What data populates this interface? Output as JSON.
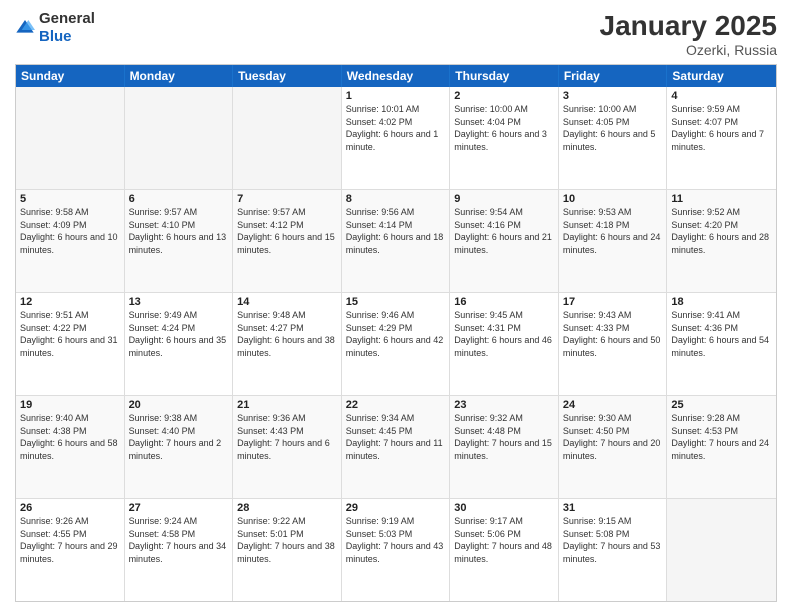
{
  "header": {
    "logo_general": "General",
    "logo_blue": "Blue",
    "title": "January 2025",
    "location": "Ozerki, Russia"
  },
  "days_of_week": [
    "Sunday",
    "Monday",
    "Tuesday",
    "Wednesday",
    "Thursday",
    "Friday",
    "Saturday"
  ],
  "weeks": [
    {
      "cells": [
        {
          "day": "",
          "empty": true
        },
        {
          "day": "",
          "empty": true
        },
        {
          "day": "",
          "empty": true
        },
        {
          "day": "1",
          "sunrise": "Sunrise: 10:01 AM",
          "sunset": "Sunset: 4:02 PM",
          "daylight": "Daylight: 6 hours and 1 minute."
        },
        {
          "day": "2",
          "sunrise": "Sunrise: 10:00 AM",
          "sunset": "Sunset: 4:04 PM",
          "daylight": "Daylight: 6 hours and 3 minutes."
        },
        {
          "day": "3",
          "sunrise": "Sunrise: 10:00 AM",
          "sunset": "Sunset: 4:05 PM",
          "daylight": "Daylight: 6 hours and 5 minutes."
        },
        {
          "day": "4",
          "sunrise": "Sunrise: 9:59 AM",
          "sunset": "Sunset: 4:07 PM",
          "daylight": "Daylight: 6 hours and 7 minutes."
        }
      ]
    },
    {
      "cells": [
        {
          "day": "5",
          "sunrise": "Sunrise: 9:58 AM",
          "sunset": "Sunset: 4:09 PM",
          "daylight": "Daylight: 6 hours and 10 minutes."
        },
        {
          "day": "6",
          "sunrise": "Sunrise: 9:57 AM",
          "sunset": "Sunset: 4:10 PM",
          "daylight": "Daylight: 6 hours and 13 minutes."
        },
        {
          "day": "7",
          "sunrise": "Sunrise: 9:57 AM",
          "sunset": "Sunset: 4:12 PM",
          "daylight": "Daylight: 6 hours and 15 minutes."
        },
        {
          "day": "8",
          "sunrise": "Sunrise: 9:56 AM",
          "sunset": "Sunset: 4:14 PM",
          "daylight": "Daylight: 6 hours and 18 minutes."
        },
        {
          "day": "9",
          "sunrise": "Sunrise: 9:54 AM",
          "sunset": "Sunset: 4:16 PM",
          "daylight": "Daylight: 6 hours and 21 minutes."
        },
        {
          "day": "10",
          "sunrise": "Sunrise: 9:53 AM",
          "sunset": "Sunset: 4:18 PM",
          "daylight": "Daylight: 6 hours and 24 minutes."
        },
        {
          "day": "11",
          "sunrise": "Sunrise: 9:52 AM",
          "sunset": "Sunset: 4:20 PM",
          "daylight": "Daylight: 6 hours and 28 minutes."
        }
      ]
    },
    {
      "cells": [
        {
          "day": "12",
          "sunrise": "Sunrise: 9:51 AM",
          "sunset": "Sunset: 4:22 PM",
          "daylight": "Daylight: 6 hours and 31 minutes."
        },
        {
          "day": "13",
          "sunrise": "Sunrise: 9:49 AM",
          "sunset": "Sunset: 4:24 PM",
          "daylight": "Daylight: 6 hours and 35 minutes."
        },
        {
          "day": "14",
          "sunrise": "Sunrise: 9:48 AM",
          "sunset": "Sunset: 4:27 PM",
          "daylight": "Daylight: 6 hours and 38 minutes."
        },
        {
          "day": "15",
          "sunrise": "Sunrise: 9:46 AM",
          "sunset": "Sunset: 4:29 PM",
          "daylight": "Daylight: 6 hours and 42 minutes."
        },
        {
          "day": "16",
          "sunrise": "Sunrise: 9:45 AM",
          "sunset": "Sunset: 4:31 PM",
          "daylight": "Daylight: 6 hours and 46 minutes."
        },
        {
          "day": "17",
          "sunrise": "Sunrise: 9:43 AM",
          "sunset": "Sunset: 4:33 PM",
          "daylight": "Daylight: 6 hours and 50 minutes."
        },
        {
          "day": "18",
          "sunrise": "Sunrise: 9:41 AM",
          "sunset": "Sunset: 4:36 PM",
          "daylight": "Daylight: 6 hours and 54 minutes."
        }
      ]
    },
    {
      "cells": [
        {
          "day": "19",
          "sunrise": "Sunrise: 9:40 AM",
          "sunset": "Sunset: 4:38 PM",
          "daylight": "Daylight: 6 hours and 58 minutes."
        },
        {
          "day": "20",
          "sunrise": "Sunrise: 9:38 AM",
          "sunset": "Sunset: 4:40 PM",
          "daylight": "Daylight: 7 hours and 2 minutes."
        },
        {
          "day": "21",
          "sunrise": "Sunrise: 9:36 AM",
          "sunset": "Sunset: 4:43 PM",
          "daylight": "Daylight: 7 hours and 6 minutes."
        },
        {
          "day": "22",
          "sunrise": "Sunrise: 9:34 AM",
          "sunset": "Sunset: 4:45 PM",
          "daylight": "Daylight: 7 hours and 11 minutes."
        },
        {
          "day": "23",
          "sunrise": "Sunrise: 9:32 AM",
          "sunset": "Sunset: 4:48 PM",
          "daylight": "Daylight: 7 hours and 15 minutes."
        },
        {
          "day": "24",
          "sunrise": "Sunrise: 9:30 AM",
          "sunset": "Sunset: 4:50 PM",
          "daylight": "Daylight: 7 hours and 20 minutes."
        },
        {
          "day": "25",
          "sunrise": "Sunrise: 9:28 AM",
          "sunset": "Sunset: 4:53 PM",
          "daylight": "Daylight: 7 hours and 24 minutes."
        }
      ]
    },
    {
      "cells": [
        {
          "day": "26",
          "sunrise": "Sunrise: 9:26 AM",
          "sunset": "Sunset: 4:55 PM",
          "daylight": "Daylight: 7 hours and 29 minutes."
        },
        {
          "day": "27",
          "sunrise": "Sunrise: 9:24 AM",
          "sunset": "Sunset: 4:58 PM",
          "daylight": "Daylight: 7 hours and 34 minutes."
        },
        {
          "day": "28",
          "sunrise": "Sunrise: 9:22 AM",
          "sunset": "Sunset: 5:01 PM",
          "daylight": "Daylight: 7 hours and 38 minutes."
        },
        {
          "day": "29",
          "sunrise": "Sunrise: 9:19 AM",
          "sunset": "Sunset: 5:03 PM",
          "daylight": "Daylight: 7 hours and 43 minutes."
        },
        {
          "day": "30",
          "sunrise": "Sunrise: 9:17 AM",
          "sunset": "Sunset: 5:06 PM",
          "daylight": "Daylight: 7 hours and 48 minutes."
        },
        {
          "day": "31",
          "sunrise": "Sunrise: 9:15 AM",
          "sunset": "Sunset: 5:08 PM",
          "daylight": "Daylight: 7 hours and 53 minutes."
        },
        {
          "day": "",
          "empty": true
        }
      ]
    }
  ]
}
